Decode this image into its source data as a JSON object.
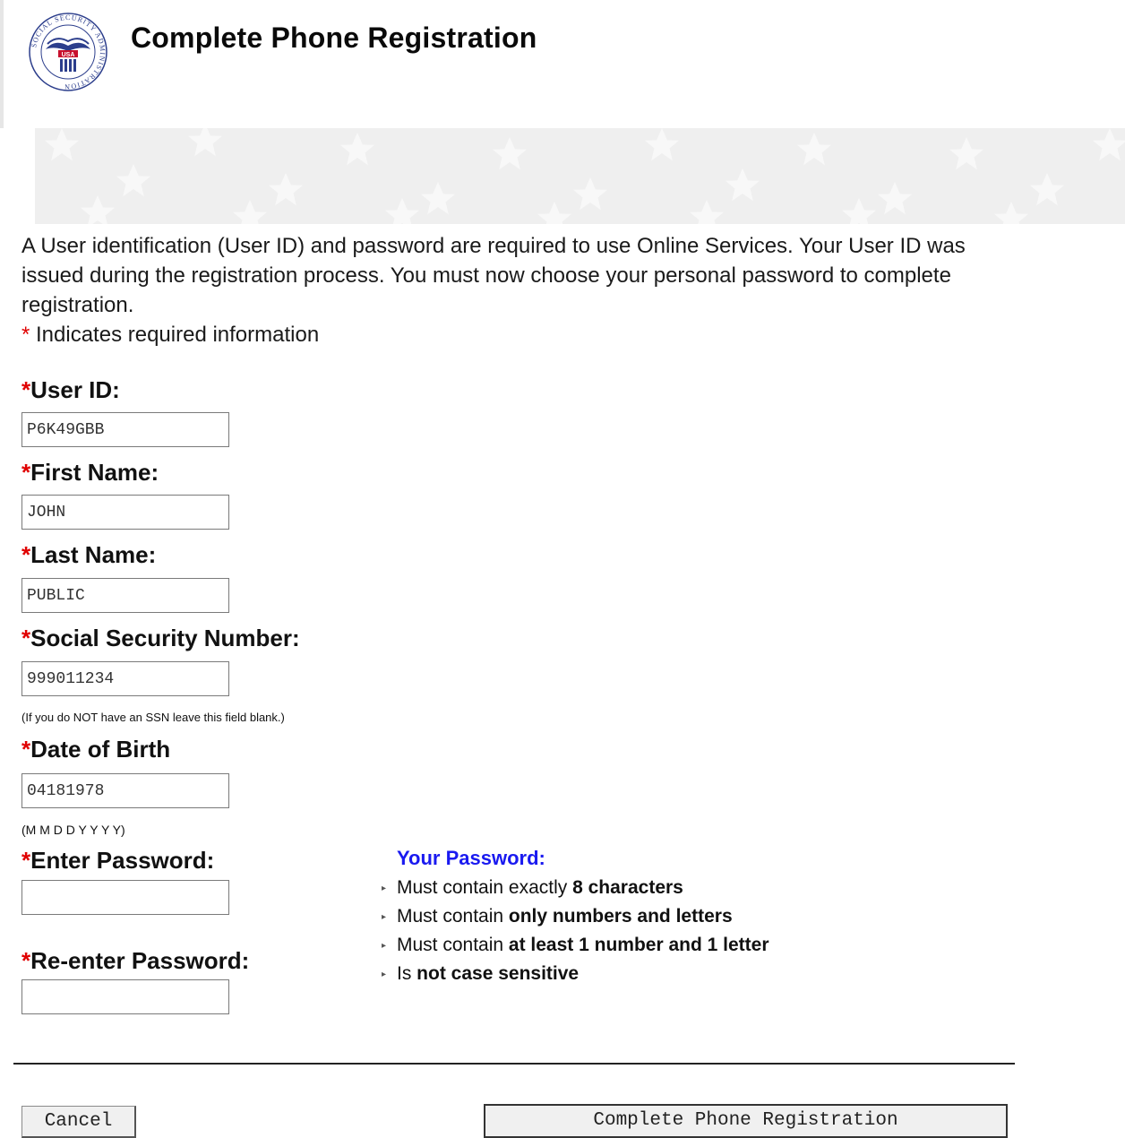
{
  "header": {
    "title": "Complete Phone Registration",
    "logo": {
      "ring_text": "SOCIAL SECURITY ADMINISTRATION",
      "center_text": "USA"
    }
  },
  "intro": {
    "text": "A User identification (User ID) and password are required to use Online Services. Your User ID was issued during the registration process. You must now choose your personal password to complete registration.",
    "required_mark": "*",
    "required_note": " Indicates required information"
  },
  "form": {
    "required_mark": "*",
    "user_id": {
      "label": "User ID:",
      "value": "P6K49GBB"
    },
    "first_name": {
      "label": "First Name:",
      "value": "JOHN"
    },
    "last_name": {
      "label": "Last Name:",
      "value": "PUBLIC"
    },
    "ssn": {
      "label": "Social Security Number:",
      "value": "999011234",
      "hint": "(If you do NOT have an SSN leave this field blank.)"
    },
    "dob": {
      "label": "Date of Birth",
      "value": "04181978",
      "hint": "(M M D D Y Y Y Y)"
    },
    "password": {
      "label": "Enter Password:",
      "value": ""
    },
    "reenter_password": {
      "label": "Re-enter Password:",
      "value": ""
    }
  },
  "password_rules": {
    "title": "Your Password:",
    "items": [
      {
        "prefix": "Must contain exactly ",
        "emphasis": "8 characters"
      },
      {
        "prefix": "Must contain ",
        "emphasis": "only numbers and letters"
      },
      {
        "prefix": "Must contain ",
        "emphasis": "at least 1 number and 1 letter"
      },
      {
        "prefix": "Is ",
        "emphasis": "not case sensitive"
      }
    ]
  },
  "buttons": {
    "cancel": "Cancel",
    "complete": "Complete Phone Registration"
  },
  "colors": {
    "required": "#e00000",
    "rules_title": "#1a1af0",
    "banner_bg": "#efefef"
  }
}
